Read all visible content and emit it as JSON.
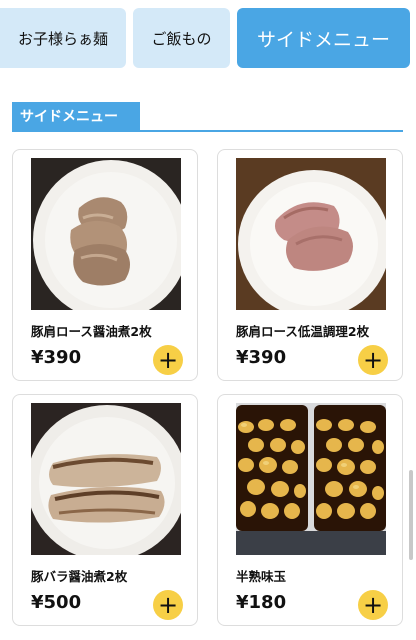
{
  "tabs": [
    {
      "label": "お子様らぁ麺",
      "active": false
    },
    {
      "label": "ご飯もの",
      "active": false
    },
    {
      "label": "サイドメニュー",
      "active": true
    }
  ],
  "section": {
    "title": "サイドメニュー"
  },
  "products": [
    {
      "name": "豚肩ロース醤油煮2枚",
      "price": "¥390",
      "add_icon": "plus-icon"
    },
    {
      "name": "豚肩ロース低温調理2枚",
      "price": "¥390",
      "add_icon": "plus-icon"
    },
    {
      "name": "豚バラ醤油煮2枚",
      "price": "¥500",
      "add_icon": "plus-icon"
    },
    {
      "name": "半熟味玉",
      "price": "¥180",
      "add_icon": "plus-icon"
    }
  ],
  "colors": {
    "accent": "#4aa6e4",
    "tab_inactive": "#d4e9f8",
    "add_button": "#f7cf46"
  }
}
